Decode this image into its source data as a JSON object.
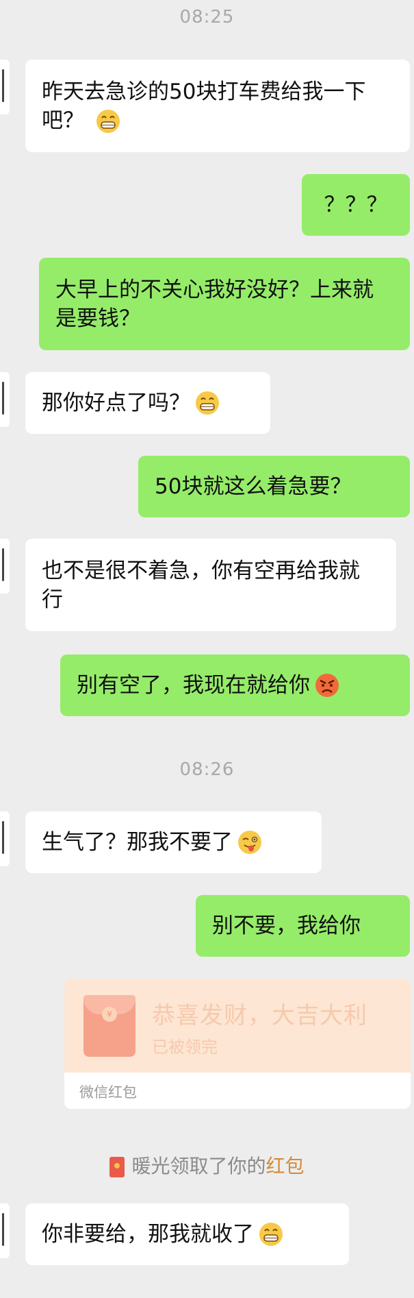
{
  "colors": {
    "background": "#ededed",
    "incoming_bubble": "#ffffff",
    "outgoing_bubble": "#95ec69",
    "red_packet": "#fde6d3",
    "link": "#d68a39"
  },
  "timestamps": [
    "08:25",
    "08:26"
  ],
  "messages": [
    {
      "side": "in",
      "text": "昨天去急诊的50块打车费给我一下吧？",
      "emoji": "grinning-emoji"
    },
    {
      "side": "out",
      "text": "？？？"
    },
    {
      "side": "out",
      "text": "大早上的不关心我好没好？上来就是要钱？"
    },
    {
      "side": "in",
      "text": "那你好点了吗？",
      "emoji": "grinning-emoji"
    },
    {
      "side": "out",
      "text": "50块就这么着急要？"
    },
    {
      "side": "in",
      "text": "也不是很不着急，你有空再给我就行"
    },
    {
      "side": "out",
      "text": "别有空了，我现在就给你",
      "emoji": "angry-emoji"
    },
    {
      "side": "in",
      "text": "生气了？那我不要了",
      "emoji": "winking-tongue-emoji"
    },
    {
      "side": "out",
      "text": "别不要，我给你"
    },
    {
      "side": "in",
      "text": "你非要给，那我就收了",
      "emoji": "grinning-emoji"
    }
  ],
  "red_packet": {
    "title": "恭喜发财，大吉大利",
    "status": "已被领完",
    "footer": "微信红包"
  },
  "notice": {
    "text": "暖光领取了你的",
    "link": "红包",
    "icon": "red-envelope-icon"
  }
}
